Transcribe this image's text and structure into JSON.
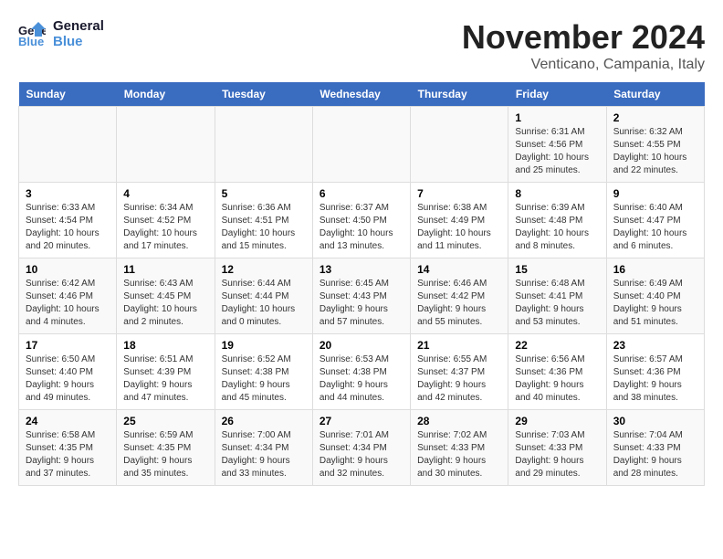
{
  "logo": {
    "line1": "General",
    "line2": "Blue"
  },
  "title": "November 2024",
  "location": "Venticano, Campania, Italy",
  "weekdays": [
    "Sunday",
    "Monday",
    "Tuesday",
    "Wednesday",
    "Thursday",
    "Friday",
    "Saturday"
  ],
  "weeks": [
    [
      {
        "day": "",
        "info": ""
      },
      {
        "day": "",
        "info": ""
      },
      {
        "day": "",
        "info": ""
      },
      {
        "day": "",
        "info": ""
      },
      {
        "day": "",
        "info": ""
      },
      {
        "day": "1",
        "info": "Sunrise: 6:31 AM\nSunset: 4:56 PM\nDaylight: 10 hours and 25 minutes."
      },
      {
        "day": "2",
        "info": "Sunrise: 6:32 AM\nSunset: 4:55 PM\nDaylight: 10 hours and 22 minutes."
      }
    ],
    [
      {
        "day": "3",
        "info": "Sunrise: 6:33 AM\nSunset: 4:54 PM\nDaylight: 10 hours and 20 minutes."
      },
      {
        "day": "4",
        "info": "Sunrise: 6:34 AM\nSunset: 4:52 PM\nDaylight: 10 hours and 17 minutes."
      },
      {
        "day": "5",
        "info": "Sunrise: 6:36 AM\nSunset: 4:51 PM\nDaylight: 10 hours and 15 minutes."
      },
      {
        "day": "6",
        "info": "Sunrise: 6:37 AM\nSunset: 4:50 PM\nDaylight: 10 hours and 13 minutes."
      },
      {
        "day": "7",
        "info": "Sunrise: 6:38 AM\nSunset: 4:49 PM\nDaylight: 10 hours and 11 minutes."
      },
      {
        "day": "8",
        "info": "Sunrise: 6:39 AM\nSunset: 4:48 PM\nDaylight: 10 hours and 8 minutes."
      },
      {
        "day": "9",
        "info": "Sunrise: 6:40 AM\nSunset: 4:47 PM\nDaylight: 10 hours and 6 minutes."
      }
    ],
    [
      {
        "day": "10",
        "info": "Sunrise: 6:42 AM\nSunset: 4:46 PM\nDaylight: 10 hours and 4 minutes."
      },
      {
        "day": "11",
        "info": "Sunrise: 6:43 AM\nSunset: 4:45 PM\nDaylight: 10 hours and 2 minutes."
      },
      {
        "day": "12",
        "info": "Sunrise: 6:44 AM\nSunset: 4:44 PM\nDaylight: 10 hours and 0 minutes."
      },
      {
        "day": "13",
        "info": "Sunrise: 6:45 AM\nSunset: 4:43 PM\nDaylight: 9 hours and 57 minutes."
      },
      {
        "day": "14",
        "info": "Sunrise: 6:46 AM\nSunset: 4:42 PM\nDaylight: 9 hours and 55 minutes."
      },
      {
        "day": "15",
        "info": "Sunrise: 6:48 AM\nSunset: 4:41 PM\nDaylight: 9 hours and 53 minutes."
      },
      {
        "day": "16",
        "info": "Sunrise: 6:49 AM\nSunset: 4:40 PM\nDaylight: 9 hours and 51 minutes."
      }
    ],
    [
      {
        "day": "17",
        "info": "Sunrise: 6:50 AM\nSunset: 4:40 PM\nDaylight: 9 hours and 49 minutes."
      },
      {
        "day": "18",
        "info": "Sunrise: 6:51 AM\nSunset: 4:39 PM\nDaylight: 9 hours and 47 minutes."
      },
      {
        "day": "19",
        "info": "Sunrise: 6:52 AM\nSunset: 4:38 PM\nDaylight: 9 hours and 45 minutes."
      },
      {
        "day": "20",
        "info": "Sunrise: 6:53 AM\nSunset: 4:38 PM\nDaylight: 9 hours and 44 minutes."
      },
      {
        "day": "21",
        "info": "Sunrise: 6:55 AM\nSunset: 4:37 PM\nDaylight: 9 hours and 42 minutes."
      },
      {
        "day": "22",
        "info": "Sunrise: 6:56 AM\nSunset: 4:36 PM\nDaylight: 9 hours and 40 minutes."
      },
      {
        "day": "23",
        "info": "Sunrise: 6:57 AM\nSunset: 4:36 PM\nDaylight: 9 hours and 38 minutes."
      }
    ],
    [
      {
        "day": "24",
        "info": "Sunrise: 6:58 AM\nSunset: 4:35 PM\nDaylight: 9 hours and 37 minutes."
      },
      {
        "day": "25",
        "info": "Sunrise: 6:59 AM\nSunset: 4:35 PM\nDaylight: 9 hours and 35 minutes."
      },
      {
        "day": "26",
        "info": "Sunrise: 7:00 AM\nSunset: 4:34 PM\nDaylight: 9 hours and 33 minutes."
      },
      {
        "day": "27",
        "info": "Sunrise: 7:01 AM\nSunset: 4:34 PM\nDaylight: 9 hours and 32 minutes."
      },
      {
        "day": "28",
        "info": "Sunrise: 7:02 AM\nSunset: 4:33 PM\nDaylight: 9 hours and 30 minutes."
      },
      {
        "day": "29",
        "info": "Sunrise: 7:03 AM\nSunset: 4:33 PM\nDaylight: 9 hours and 29 minutes."
      },
      {
        "day": "30",
        "info": "Sunrise: 7:04 AM\nSunset: 4:33 PM\nDaylight: 9 hours and 28 minutes."
      }
    ]
  ]
}
